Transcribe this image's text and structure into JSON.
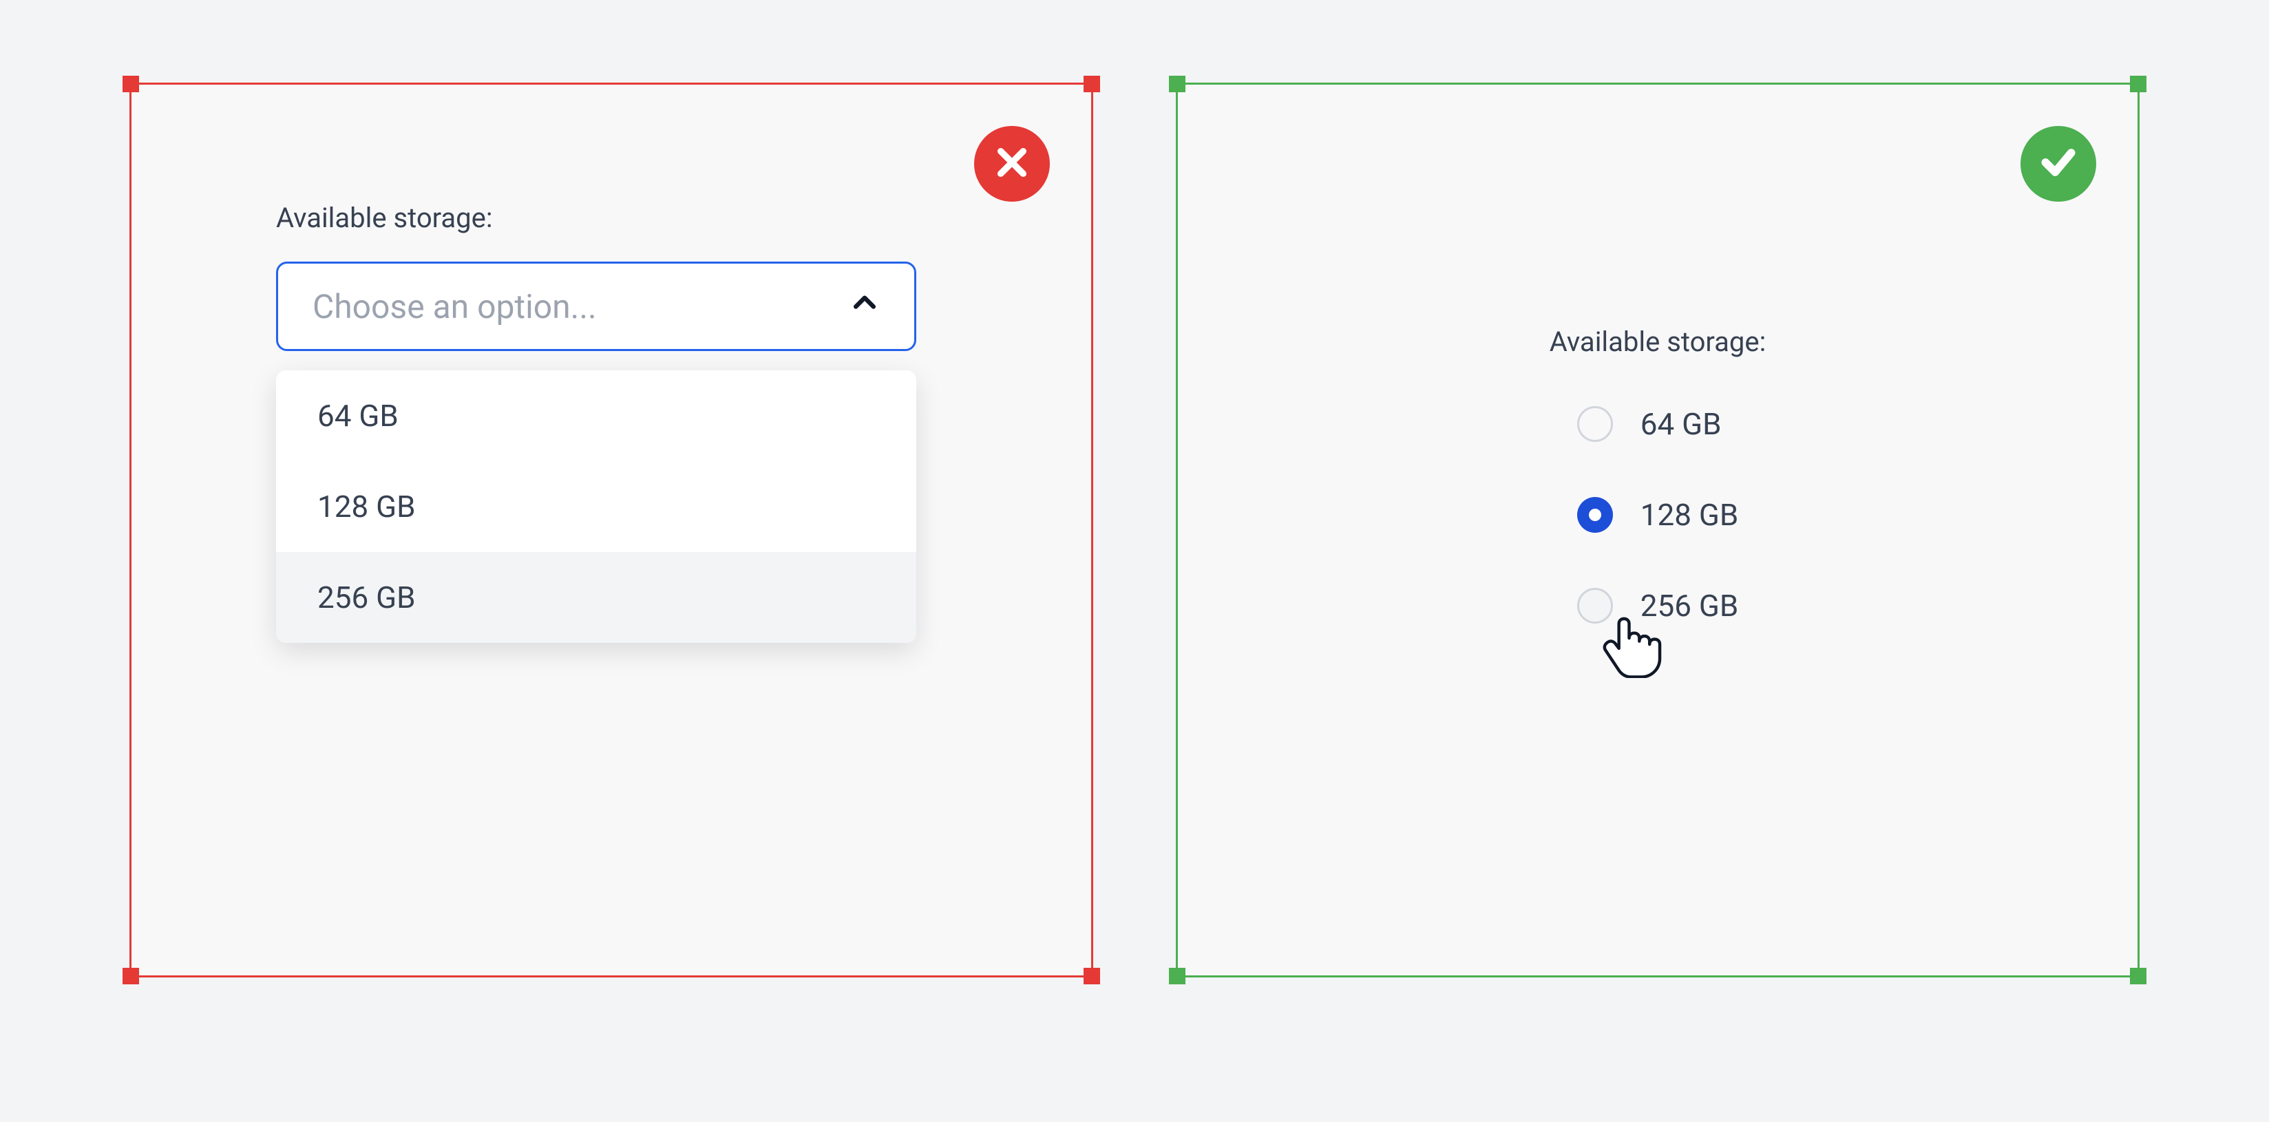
{
  "left": {
    "label": "Available storage:",
    "selectPlaceholder": "Choose an option...",
    "options": [
      "64 GB",
      "128 GB",
      "256 GB"
    ],
    "hoveredIndex": 2
  },
  "right": {
    "label": "Available storage:",
    "options": [
      "64 GB",
      "128 GB",
      "256 GB"
    ],
    "selectedIndex": 1,
    "hoveringIndex": 2
  },
  "colors": {
    "bad": "#e53935",
    "good": "#4caf50",
    "accent": "#1d4ed8"
  }
}
